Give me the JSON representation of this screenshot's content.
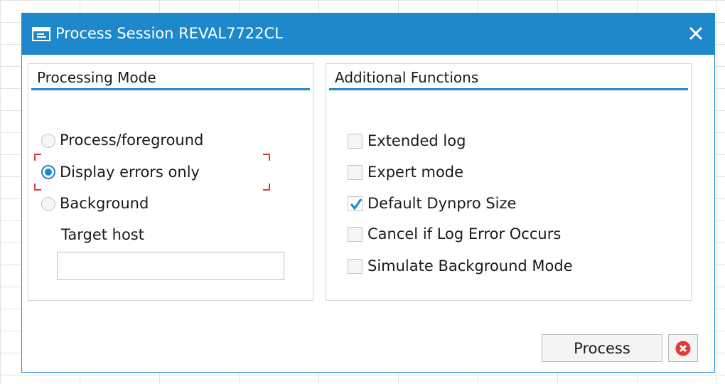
{
  "dialog": {
    "title": "Process Session REVAL7722CL",
    "title_icon": "session-icon",
    "close_icon": "close-icon",
    "accent_color": "#1e88cc"
  },
  "processing_mode": {
    "heading": "Processing Mode",
    "options": [
      {
        "label": "Process/foreground",
        "selected": false
      },
      {
        "label": "Display errors only",
        "selected": true
      },
      {
        "label": "Background",
        "selected": false
      }
    ],
    "target_host_label": "Target host",
    "target_host_value": ""
  },
  "additional_functions": {
    "heading": "Additional Functions",
    "options": [
      {
        "label": "Extended log",
        "checked": false
      },
      {
        "label": "Expert mode",
        "checked": false
      },
      {
        "label": "Default Dynpro Size",
        "checked": true
      },
      {
        "label": "Cancel if Log Error Occurs",
        "checked": false
      },
      {
        "label": "Simulate Background Mode",
        "checked": false
      }
    ]
  },
  "footer": {
    "process_label": "Process",
    "cancel_icon": "cancel-icon",
    "cancel_color": "#e53935"
  }
}
